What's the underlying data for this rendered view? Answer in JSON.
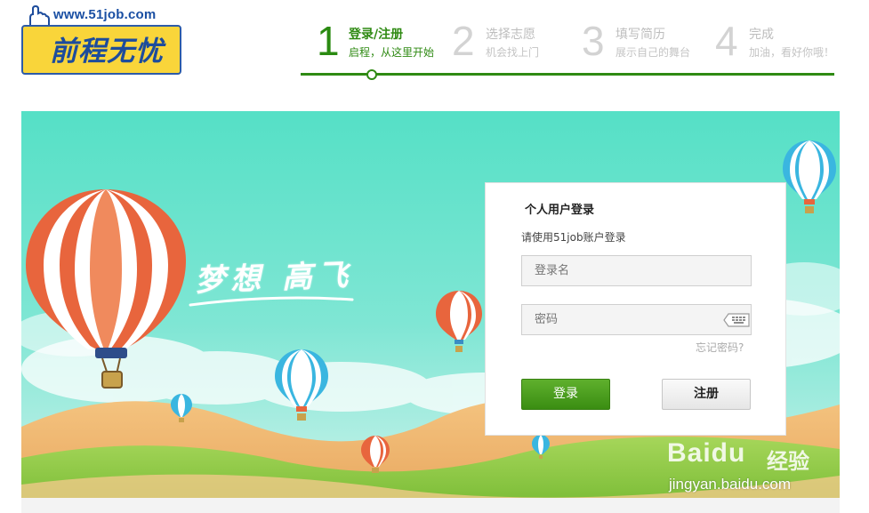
{
  "logo": {
    "url_text": "www.51job.com",
    "name": "前程无忧"
  },
  "steps": [
    {
      "num": "1",
      "title": "登录/注册",
      "sub": "启程，从这里开始",
      "active": true
    },
    {
      "num": "2",
      "title": "选择志愿",
      "sub": "机会找上门",
      "active": false
    },
    {
      "num": "3",
      "title": "填写简历",
      "sub": "展示自己的舞台",
      "active": false
    },
    {
      "num": "4",
      "title": "完成",
      "sub": "加油，看好你哦！",
      "active": false
    }
  ],
  "banner": {
    "slogan": "梦想 高飞"
  },
  "login": {
    "title": "个人用户登录",
    "hint": "请使用51job账户登录",
    "username_placeholder": "登录名",
    "password_placeholder": "密码",
    "forgot_label": "忘记密码?",
    "login_button": "登录",
    "register_button": "注册"
  },
  "watermark": {
    "brand": "Baidu",
    "brand_cn": "经验",
    "url": "jingyan.baidu.com"
  },
  "icons": {
    "keyboard": "keyboard-icon",
    "hand": "hand-icon"
  },
  "colors": {
    "accent_green": "#2f8a13",
    "button_green": "#4a9e1c",
    "logo_yellow": "#f9d53a",
    "logo_blue": "#1d4c9c",
    "sky": "#4fdcc6"
  }
}
